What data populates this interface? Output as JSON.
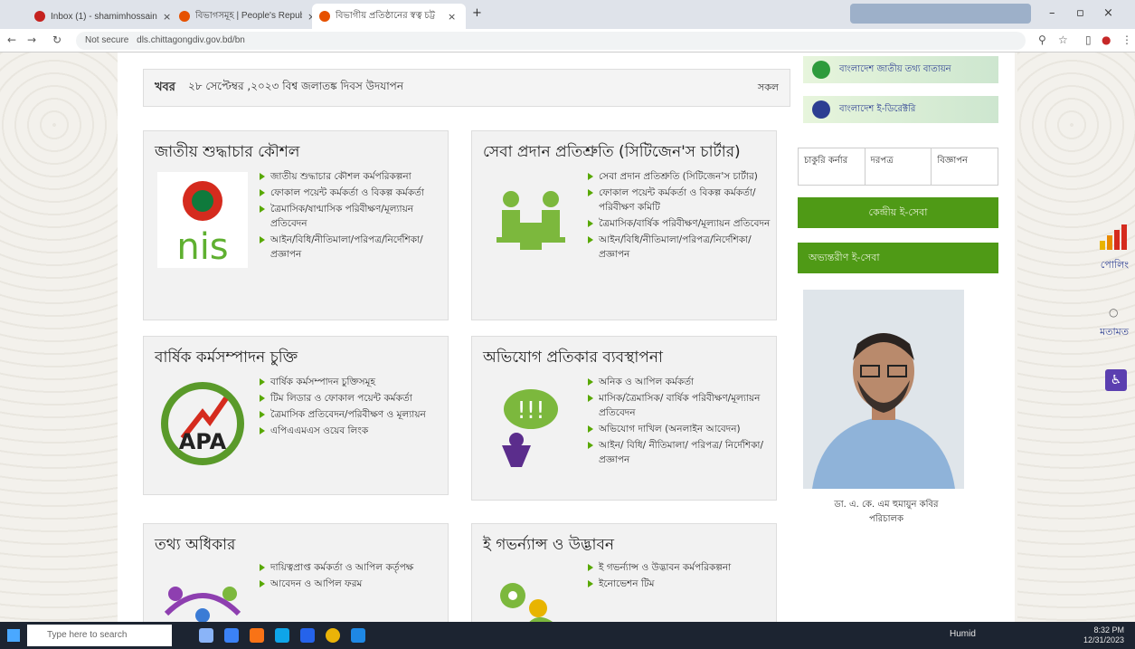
{
  "browser": {
    "tabs": [
      {
        "title": "Inbox (1) - shamimhossaintev@...",
        "color": "#c5221f"
      },
      {
        "title": "বিভাগসমূহ | People's Republic",
        "color": "#e65100"
      },
      {
        "title": "বিভাগীয় প্রতিষ্ঠানের স্বত্ব চট্ট",
        "color": "#e65100"
      }
    ],
    "new_tab": "+",
    "url_security": "Not secure",
    "url": "dls.chittagongdiv.gov.bd/bn"
  },
  "news": {
    "label": "খবর",
    "text": "২৮ সেপ্টেম্বর ,২০২৩ বিশ্ব জলাতঙ্ক দিবস উদযাপন",
    "all": "সকল"
  },
  "cards": [
    {
      "title": "জাতীয় শুদ্ধাচার কৌশল",
      "img": "NIS",
      "items": [
        "জাতীয় শুদ্ধাচার কৌশল কর্মপরিকল্পনা",
        "ফোকাল পয়েন্ট কর্মকর্তা ও বিকল্প কর্মকর্তা",
        "ত্রৈমাসিক/ষাণ্মাসিক পরিবীক্ষণ/মূল্যায়ন প্রতিবেদন",
        "আইন/বিধি/নীতিমালা/পরিপত্র/নির্দেশিকা/প্রজ্ঞাপন"
      ]
    },
    {
      "title": "সেবা প্রদান প্রতিশ্রুতি (সিটিজেন'স চার্টার)",
      "img": "citizen",
      "items": [
        "সেবা প্রদান প্রতিশ্রুতি (সিটিজেন'স চার্টার)",
        "ফোকাল পয়েন্ট কর্মকর্তা ও বিকল্প কর্মকর্তা/ পরিবীক্ষণ কমিটি",
        "ত্রৈমাসিক/বার্ষিক পরিবীক্ষণ/মূল্যায়ন প্রতিবেদন",
        "আইন/বিধি/নীতিমালা/পরিপত্র/নির্দেশিকা/প্রজ্ঞাপন"
      ]
    },
    {
      "title": "বার্ষিক কর্মসম্পাদন চুক্তি",
      "img": "APA",
      "items": [
        "বার্ষিক কর্মসম্পাদন চুক্তিসমূহ",
        "টিম লিডার ও ফোকাল পয়েন্ট কর্মকর্তা",
        "ত্রৈমাসিক প্রতিবেদন/পরিবীক্ষণ ও মূল্যায়ন",
        "এপিএএমএস ওয়েব লিংক"
      ]
    },
    {
      "title": "অভিযোগ প্রতিকার ব্যবস্থাপনা",
      "img": "grs",
      "items": [
        "অনিক ও আপিল কর্মকর্তা",
        "মাসিক/ত্রৈমাসিক/ বার্ষিক পরিবীক্ষণ/মূল্যায়ন প্রতিবেদন",
        "অভিযোগ দাখিল (অনলাইন আবেদন)",
        "আইন/ বিধি/ নীতিমালা/ পরিপত্র/ নির্দেশিকা/প্রজ্ঞাপন"
      ]
    },
    {
      "title": "তথ্য অধিকার",
      "img": "rti",
      "items": [
        "দায়িত্বপ্রাপ্ত কর্মকর্তা ও আপিল কর্তৃপক্ষ",
        "আবেদন ও আপিল ফরম"
      ]
    },
    {
      "title": "ই গভর্ন্যান্স ও উদ্ভাবন",
      "img": "egov",
      "items": [
        "ই গভর্ন্যান্স ও উদ্ভাবন কর্মপরিকল্পনা",
        "ইনোভেশন টিম"
      ]
    }
  ],
  "right": {
    "banner1": "বাংলাদেশ জাতীয় তথ্য বাতায়ন",
    "banner2": "বাংলাদেশ ই-ডিরেক্টরি",
    "tabs": [
      "চাকুরি কর্নার",
      "দরপত্র",
      "বিজ্ঞাপন"
    ],
    "eseba": "কেন্দ্রীয় ই-সেবা",
    "other": "অভ্যন্তরীণ ই-সেবা",
    "caption_name": "ডা. এ. কে. এম হুমায়ুন কবির",
    "caption_title": "পরিচালক"
  },
  "floating": {
    "poll": "পোলিং",
    "opinion": "মতামত"
  },
  "taskbar": {
    "search": "Type here to search",
    "weather": "Humid",
    "time": "8:32 PM",
    "date": "12/31/2023"
  }
}
